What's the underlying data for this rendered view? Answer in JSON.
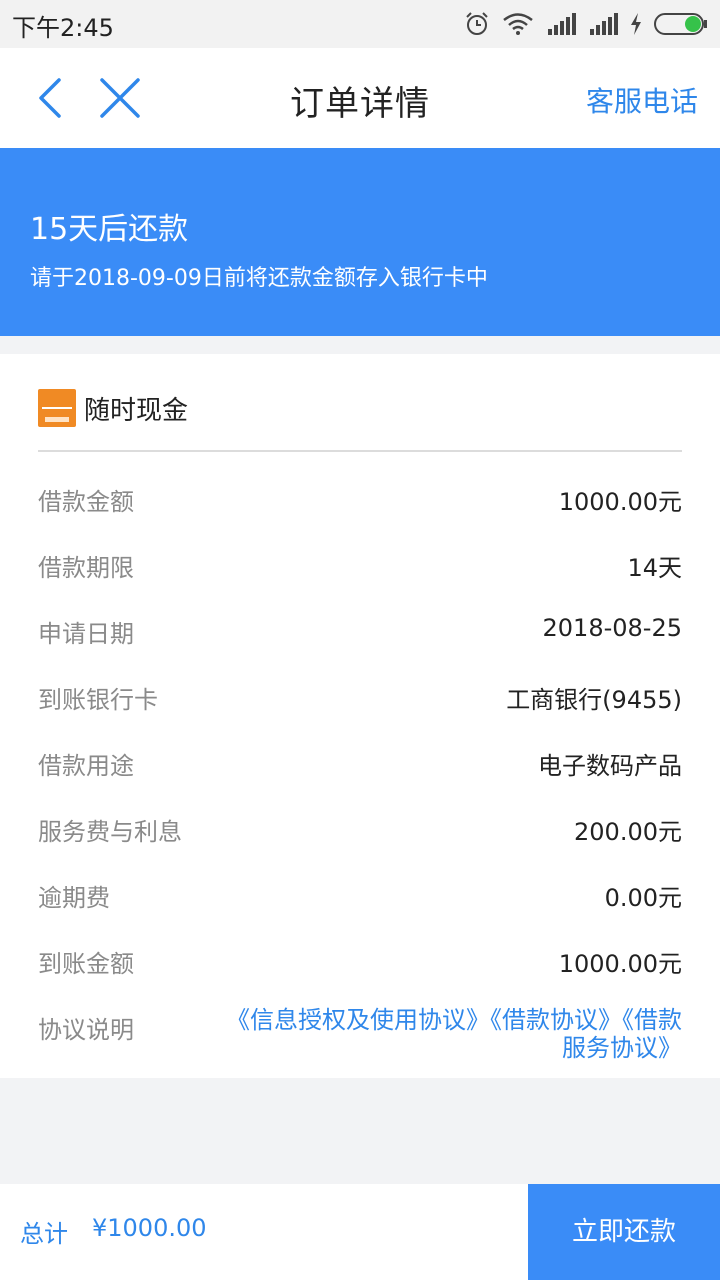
{
  "status_bar": {
    "time": "下午2:45",
    "icons": [
      "alarm-icon",
      "wifi-icon",
      "signal-icon",
      "signal-icon",
      "charging-icon",
      "battery-icon"
    ],
    "battery_color": "#36c24a"
  },
  "nav": {
    "title": "订单详情",
    "back_icon": "chevron-left-icon",
    "close_icon": "close-icon",
    "service_label": "客服电话"
  },
  "banner": {
    "title": "15天后还款",
    "subtitle": "请于2018-09-09日前将还款金额存入银行卡中",
    "color": "#3a8cf7"
  },
  "merchant": {
    "name": "随时现金",
    "logo_color": "#f08a24"
  },
  "details": [
    {
      "label": "借款金额",
      "value": "1000.00元"
    },
    {
      "label": "借款期限",
      "value": "14天"
    },
    {
      "label": "申请日期",
      "value": "2018-08-25"
    },
    {
      "label": "到账银行卡",
      "value": "工商银行(9455)"
    },
    {
      "label": "借款用途",
      "value": "电子数码产品"
    },
    {
      "label": "服务费与利息",
      "value": "200.00元"
    },
    {
      "label": "逾期费",
      "value": "0.00元"
    },
    {
      "label": "到账金额",
      "value": "1000.00元"
    }
  ],
  "agreement": {
    "label": "协议说明",
    "links": "《信息授权及使用协议》《借款协议》《借款服务协议》"
  },
  "footer": {
    "total_label": "总计",
    "total_value": "¥1000.00",
    "pay_button": "立即还款",
    "accent_color": "#2f87ea"
  }
}
